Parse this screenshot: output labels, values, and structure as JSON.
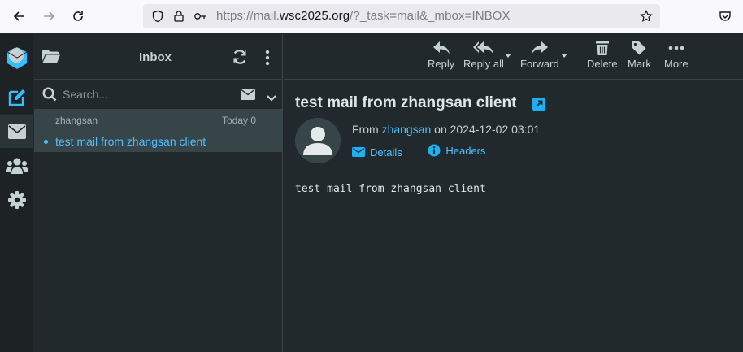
{
  "browser": {
    "url_prefix": "https://mail.",
    "url_host": "wsc2025.org",
    "url_suffix": "/?_task=mail&_mbox=INBOX",
    "icons": [
      "back-icon",
      "forward-icon",
      "reload-icon",
      "shield-icon",
      "lock-icon",
      "key-icon",
      "bookmark-star-icon",
      "pocket-icon"
    ]
  },
  "taskmenu": {
    "items": [
      "compose",
      "mail",
      "contacts",
      "settings"
    ]
  },
  "message_list": {
    "title": "Inbox",
    "search_placeholder": "Search...",
    "messages": [
      {
        "from": "zhangsan",
        "date": "Today 0",
        "subject": "test mail from zhangsan client",
        "unread": true
      }
    ]
  },
  "toolbar": {
    "reply": "Reply",
    "reply_all": "Reply all",
    "forward": "Forward",
    "delete": "Delete",
    "mark": "Mark",
    "more": "More"
  },
  "message": {
    "subject": "test mail from zhangsan client",
    "from_label": "From",
    "from_name": "zhangsan",
    "date_text": "on 2024-12-02 03:01",
    "details_label": "Details",
    "headers_label": "Headers",
    "body": "test mail from zhangsan client"
  },
  "colors": {
    "accent": "#4fc0ff",
    "background": "#21292c",
    "selected_row": "#374549"
  }
}
